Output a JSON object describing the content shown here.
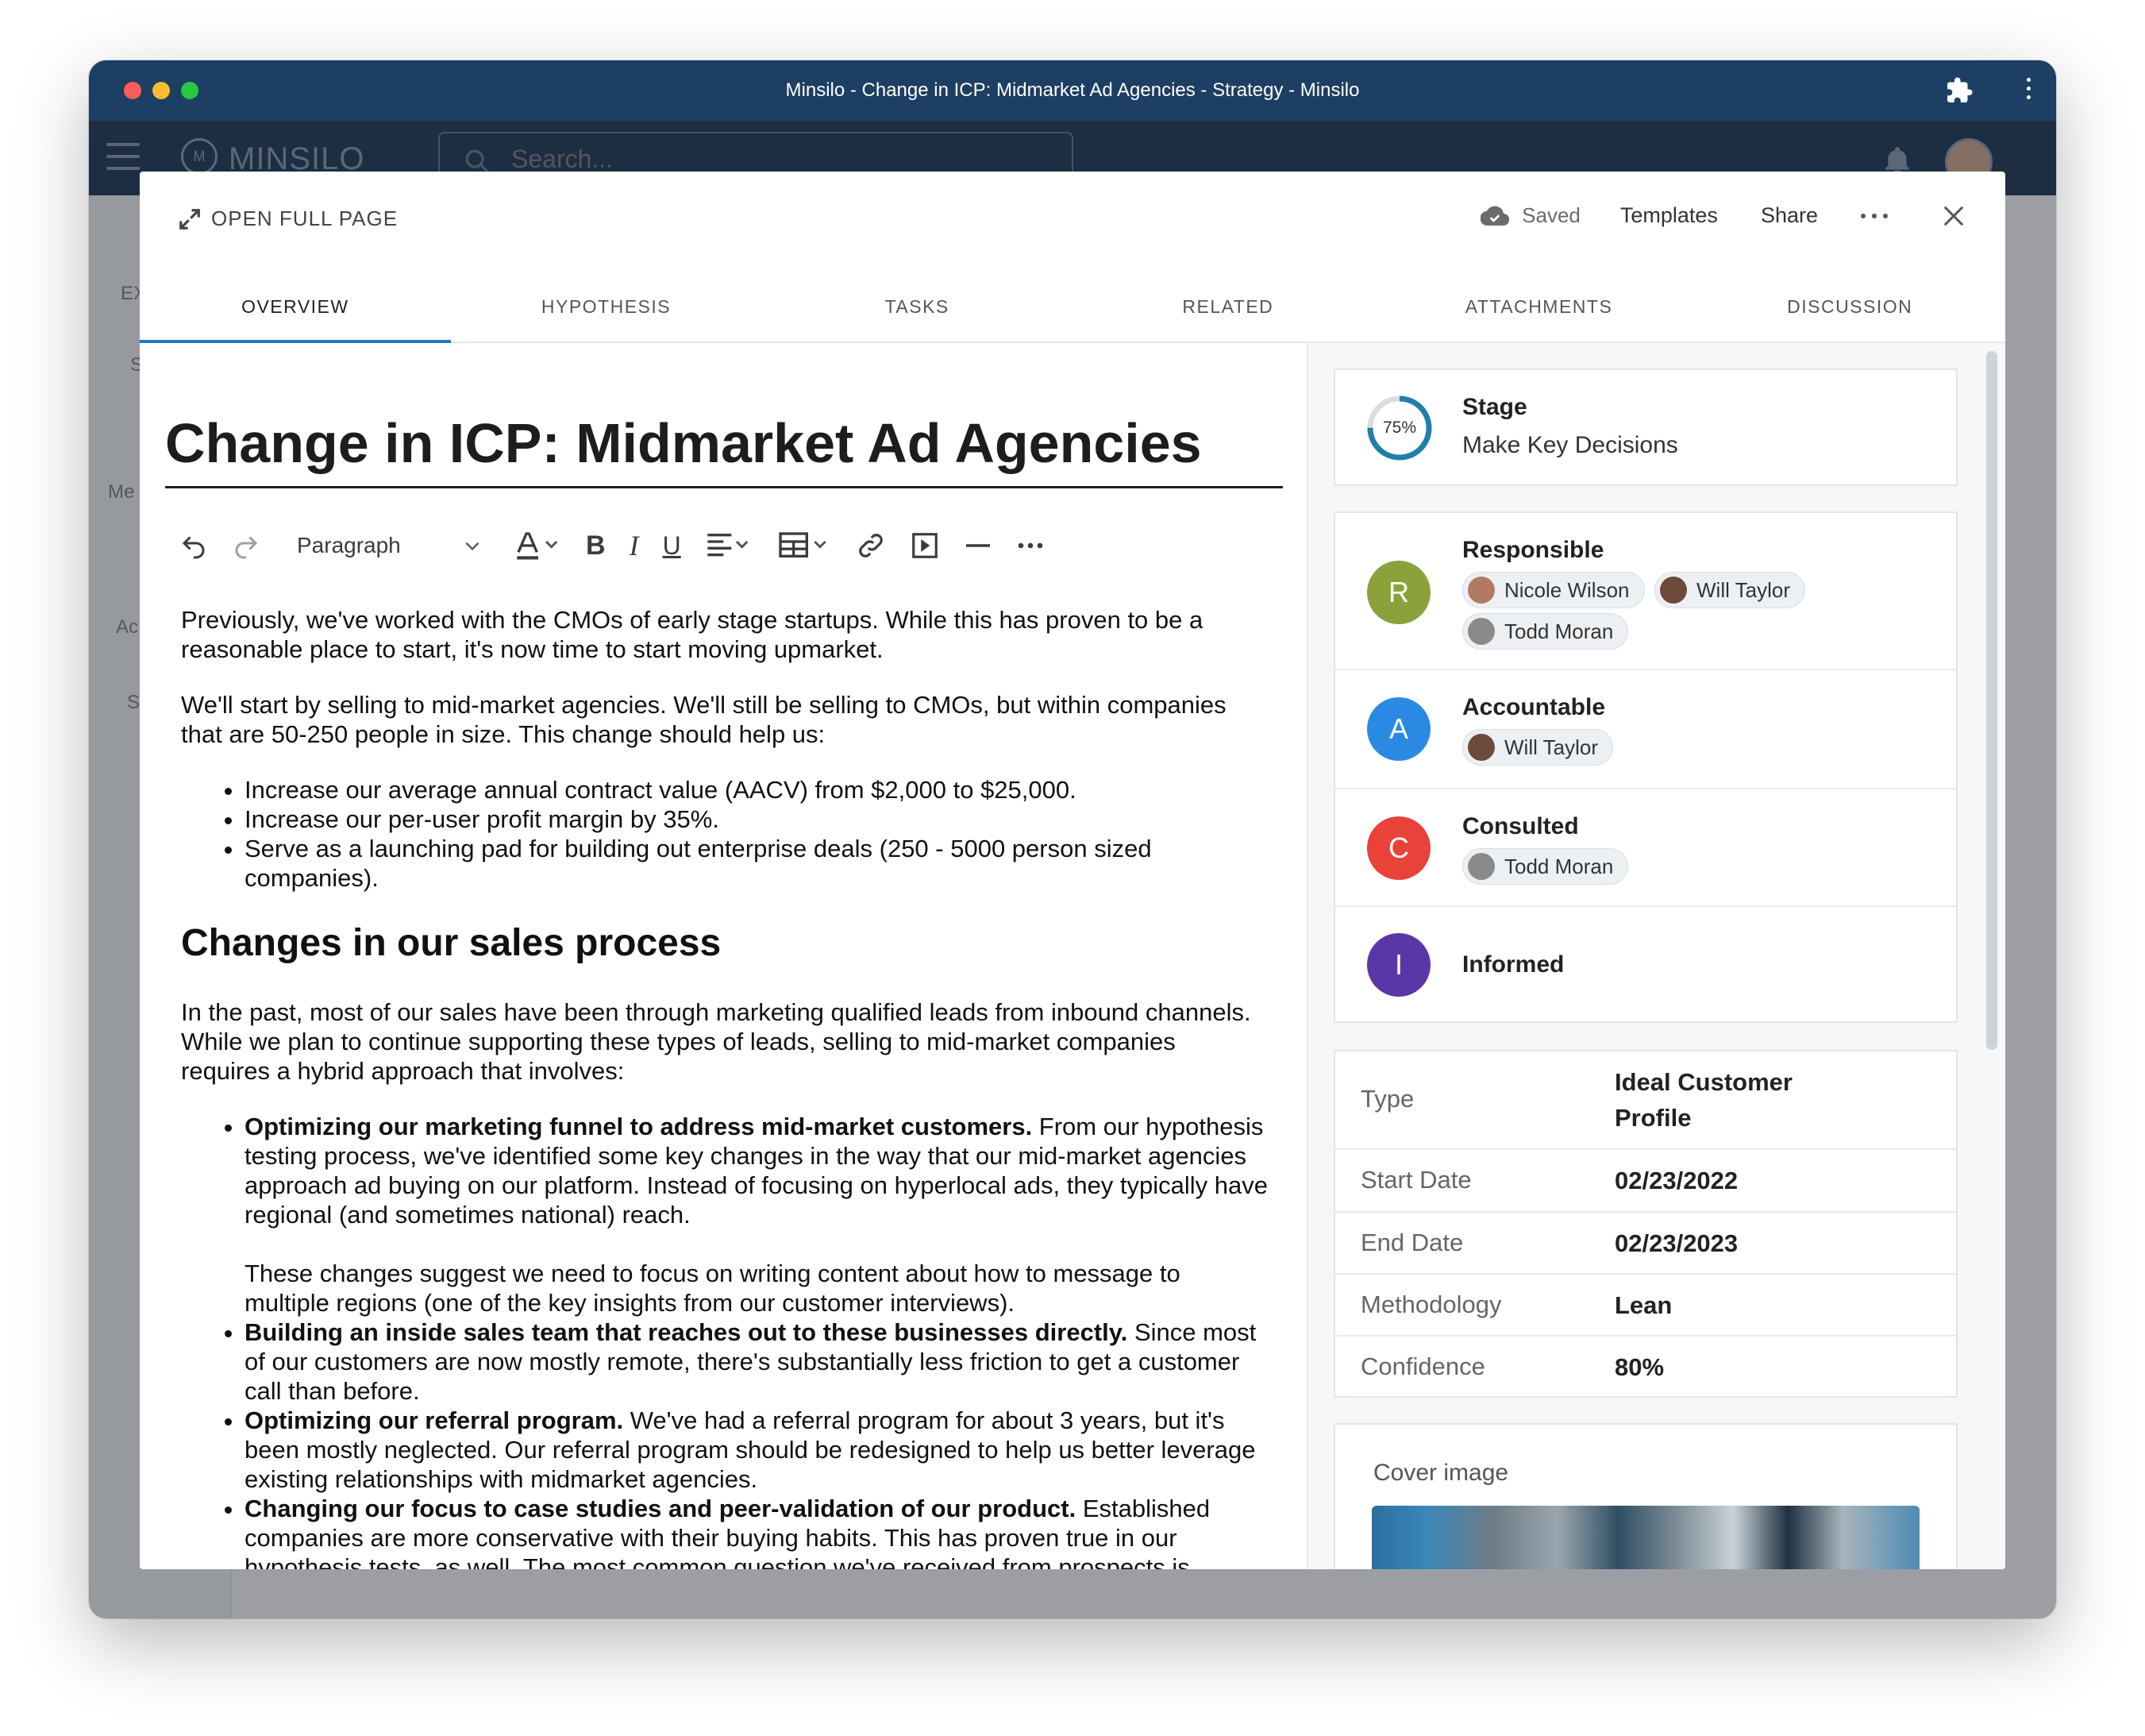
{
  "window": {
    "title": "Minsilo - Change in ICP: Midmarket Ad Agencies - Strategy - Minsilo"
  },
  "app": {
    "logo_text": "M",
    "name": "MINSILO",
    "search_placeholder": "Search..."
  },
  "background": {
    "labels": [
      "EX",
      "S",
      "Me",
      "Ac",
      "S"
    ]
  },
  "modal": {
    "open_full_page": "OPEN FULL PAGE",
    "saved": "Saved",
    "templates": "Templates",
    "share": "Share",
    "tabs": [
      {
        "label": "OVERVIEW",
        "active": true
      },
      {
        "label": "HYPOTHESIS",
        "active": false
      },
      {
        "label": "TASKS",
        "active": false
      },
      {
        "label": "RELATED",
        "active": false
      },
      {
        "label": "ATTACHMENTS",
        "active": false
      },
      {
        "label": "DISCUSSION",
        "active": false
      }
    ]
  },
  "document": {
    "title": "Change in ICP: Midmarket Ad Agencies",
    "toolbar": {
      "paragraph_style": "Paragraph"
    },
    "p1": "Previously, we've worked with the CMOs of early stage startups. While this has proven to be a reasonable place to start, it's now time to start moving upmarket.",
    "p2": "We'll start by selling to mid-market agencies. We'll still be selling to CMOs, but within companies that are 50-250 people in size. This change should help us:",
    "list1": [
      "Increase our average annual contract value (AACV) from $2,000 to $25,000.",
      "Increase our per-user profit margin by 35%.",
      "Serve as a launching pad for building out enterprise deals (250 - 5000 person sized companies)."
    ],
    "h2": "Changes in our sales process",
    "p3": "In the past, most of our sales have been through marketing qualified leads from inbound channels. While we plan to continue supporting these types of leads, selling to mid-market companies requires a hybrid approach that involves:",
    "list2": [
      {
        "bold": "Optimizing our marketing funnel to address mid-market customers.",
        "text": " From our hypothesis testing process, we've identified some key changes in the way that our mid-market agencies approach ad buying on our platform. Instead of focusing on hyperlocal ads, they typically have regional (and sometimes national) reach.",
        "extra": "These changes suggest we need to focus on writing content about how to message to multiple regions (one of the key insights from our customer interviews)."
      },
      {
        "bold": "Building an inside sales team that reaches out to these businesses directly.",
        "text": " Since most of our customers are now mostly remote, there's substantially less friction to get a customer call than before."
      },
      {
        "bold": "Optimizing our referral program.",
        "text": " We've had a referral program for about 3 years, but it's been mostly neglected. Our referral program should be redesigned to help us better leverage existing relationships with midmarket agencies."
      },
      {
        "bold": "Changing our focus to case studies and peer-validation of our product.",
        "text": " Established companies are more conservative with their buying habits. This has proven true in our hypothesis tests, as well. The most common question we've received from prospects is"
      }
    ]
  },
  "sidebar": {
    "stage": {
      "percent_label": "75%",
      "percent": 0.75,
      "label": "Stage",
      "value": "Make Key Decisions",
      "color": "#1f7fa8"
    },
    "raci": [
      {
        "letter": "R",
        "label": "Responsible",
        "color": "#8ba23a",
        "people": [
          "Nicole Wilson",
          "Will Taylor",
          "Todd Moran"
        ]
      },
      {
        "letter": "A",
        "label": "Accountable",
        "color": "#2a8ae3",
        "people": [
          "Will Taylor"
        ]
      },
      {
        "letter": "C",
        "label": "Consulted",
        "color": "#e8423b",
        "people": [
          "Todd Moran"
        ]
      },
      {
        "letter": "I",
        "label": "Informed",
        "color": "#5a36a8",
        "people": []
      }
    ],
    "meta": [
      {
        "key": "Type",
        "value": "Ideal Customer Profile"
      },
      {
        "key": "Start Date",
        "value": "02/23/2022"
      },
      {
        "key": "End Date",
        "value": "02/23/2023"
      },
      {
        "key": "Methodology",
        "value": "Lean"
      },
      {
        "key": "Confidence",
        "value": "80%"
      }
    ],
    "cover_label": "Cover image"
  }
}
